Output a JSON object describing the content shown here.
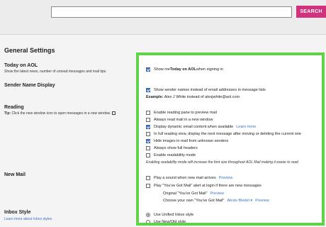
{
  "search": {
    "value": "",
    "button_label": "SEARCH"
  },
  "page_title": "General Settings",
  "sections": {
    "today": {
      "label": "Today on AOL",
      "desc": "Show the latest news, number of unread messages and mail tips."
    },
    "sender": {
      "label": "Sender Name Display"
    },
    "reading": {
      "label": "Reading",
      "tip_prefix": "Tip:",
      "tip_text": " Click the new window icon to open messages in a new window."
    },
    "newmail": {
      "label": "New Mail"
    },
    "inbox": {
      "label": "Inbox Style",
      "link": "Learn more about Inbox styles"
    }
  },
  "today_option": {
    "prefix": "Show me ",
    "bold": "Today on AOL",
    "suffix": " when signing in",
    "checked": true
  },
  "sender_option": {
    "label": "Show sender names instead of email addresses in message lists",
    "checked": true
  },
  "sender_example": {
    "prefix": "Example:",
    "text": " Alex J White instead of alexjwhite@aol.com"
  },
  "reading_options": [
    {
      "label": "Enable reading pane to preview mail",
      "checked": false,
      "link": ""
    },
    {
      "label": "Always read mail in a new window",
      "checked": false,
      "link": ""
    },
    {
      "label": "Display dynamic email content when available",
      "checked": true,
      "link": "Learn more"
    },
    {
      "label": "In full reading view, display the next message after moving or deleting the current one",
      "checked": false,
      "link": ""
    },
    {
      "label": "Hide images in mail from unknown senders",
      "checked": true,
      "link": ""
    },
    {
      "label": "Always show full headers",
      "checked": false,
      "link": ""
    },
    {
      "label": "Enable readability mode",
      "checked": false,
      "link": ""
    }
  ],
  "readability_note": "Enabling readability mode will increase the font size throughout AOL Mail making it easier to read",
  "newmail_options": [
    {
      "label": "Play a sound when new mail arrives",
      "checked": false,
      "link": "Preview"
    },
    {
      "label": "Play \"You've Got Mail\" alert at login if there are new messages",
      "checked": false,
      "link": ""
    }
  ],
  "alert_choices": {
    "original": {
      "label": "Original \"You've Got Mail\"",
      "link": "Preview"
    },
    "own": {
      "label": "Choose your own \"You've Got Mail\"",
      "selected": "Alexis Bledel",
      "link": "Preview"
    }
  },
  "inbox_options": [
    {
      "label": "Use Unified Inbox style",
      "selected": true
    },
    {
      "label": "Use New/Old style",
      "selected": false
    }
  ],
  "colors": {
    "accent": "#d1317d",
    "highlight": "#62d24a",
    "link": "#3a74c4",
    "checkbox": "#4a78c2"
  }
}
